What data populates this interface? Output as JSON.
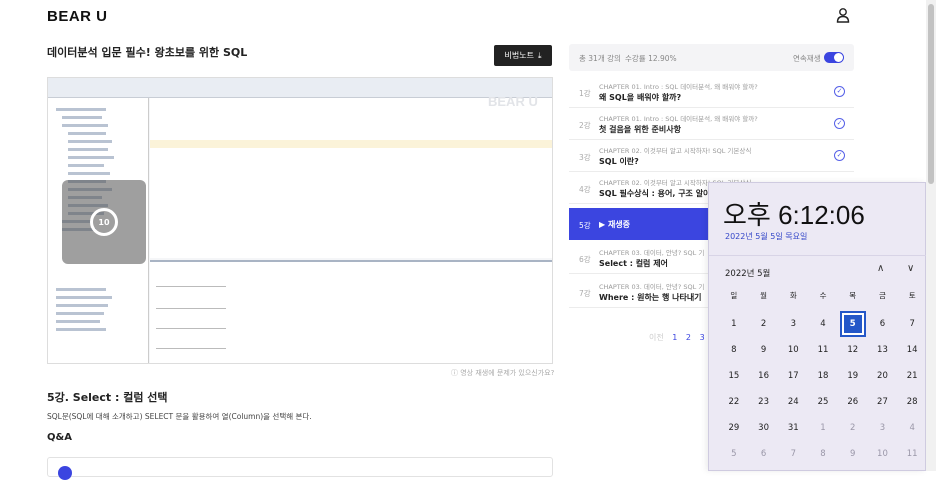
{
  "header": {
    "logo": "BEAR U",
    "user_icon": "user-icon"
  },
  "course": {
    "title": "데이터분석 입문 필수! 왕초보를 위한 SQL",
    "notes_button": "비법노트"
  },
  "video": {
    "watermark": "BEAR U",
    "replay_seconds": "10",
    "report_link": "ⓘ 영상 재생에 문제가 있으신가요?"
  },
  "lesson": {
    "title": "5강. Select : 컬럼 선택",
    "description": "SQL문(SQL에 대해 소개하고) SELECT 문을 활용하여 열(Column)을 선택해 본다.",
    "qa_title": "Q&A"
  },
  "sidebar": {
    "total": "총 31개 강의",
    "rate": "수강률 12.90%",
    "autoplay_label": "연속재생",
    "autoplay_on": true,
    "lectures": [
      {
        "num": "1강",
        "chapter": "CHAPTER 01. Intro : SQL 데이터분석, 왜 배워야 할까?",
        "name": "왜 SQL을 배워야 할까?",
        "done": true
      },
      {
        "num": "2강",
        "chapter": "CHAPTER 01. Intro : SQL 데이터분석, 왜 배워야 할까?",
        "name": "첫 걸음을 위한 준비사항",
        "done": true
      },
      {
        "num": "3강",
        "chapter": "CHAPTER 02. 이것부터 알고 시작하자! SQL 기본상식",
        "name": "SQL 이란?",
        "done": true
      },
      {
        "num": "4강",
        "chapter": "CHAPTER 02. 이것부터 알고 시작하자! SQL 기본상식",
        "name": "SQL 필수상식 : 용어, 구조 알아보",
        "done": false
      },
      {
        "num": "5강",
        "now_playing": "▶ 재생중",
        "active": true
      },
      {
        "num": "6강",
        "chapter": "CHAPTER 03. 데이터, 안녕? SQL 기",
        "name": "Select : 컬럼 제어",
        "done": false
      },
      {
        "num": "7강",
        "chapter": "CHAPTER 03. 데이터, 안녕? SQL 기",
        "name": "Where : 원하는 행 나타내기",
        "done": false
      }
    ],
    "pager": {
      "prev": "이전",
      "pages": [
        "1",
        "2",
        "3"
      ]
    }
  },
  "clock": {
    "time": "오후 6:12:06",
    "date": "2022년 5월 5일 목요일",
    "month": "2022년 5월",
    "weekdays": [
      "일",
      "월",
      "화",
      "수",
      "목",
      "금",
      "토"
    ],
    "weeks": [
      [
        {
          "d": "1"
        },
        {
          "d": "2"
        },
        {
          "d": "3"
        },
        {
          "d": "4"
        },
        {
          "d": "5",
          "today": true
        },
        {
          "d": "6"
        },
        {
          "d": "7"
        }
      ],
      [
        {
          "d": "8"
        },
        {
          "d": "9"
        },
        {
          "d": "10"
        },
        {
          "d": "11"
        },
        {
          "d": "12"
        },
        {
          "d": "13"
        },
        {
          "d": "14"
        }
      ],
      [
        {
          "d": "15"
        },
        {
          "d": "16"
        },
        {
          "d": "17"
        },
        {
          "d": "18"
        },
        {
          "d": "19"
        },
        {
          "d": "20"
        },
        {
          "d": "21"
        }
      ],
      [
        {
          "d": "22"
        },
        {
          "d": "23"
        },
        {
          "d": "24"
        },
        {
          "d": "25"
        },
        {
          "d": "26"
        },
        {
          "d": "27"
        },
        {
          "d": "28"
        }
      ],
      [
        {
          "d": "29"
        },
        {
          "d": "30"
        },
        {
          "d": "31"
        },
        {
          "d": "1",
          "other": true
        },
        {
          "d": "2",
          "other": true
        },
        {
          "d": "3",
          "other": true
        },
        {
          "d": "4",
          "other": true
        }
      ],
      [
        {
          "d": "5",
          "other": true
        },
        {
          "d": "6",
          "other": true
        },
        {
          "d": "7",
          "other": true
        },
        {
          "d": "8",
          "other": true
        },
        {
          "d": "9",
          "other": true
        },
        {
          "d": "10",
          "other": true
        },
        {
          "d": "11",
          "other": true
        }
      ]
    ]
  },
  "colors": {
    "accent": "#3b45e0",
    "today": "#2457c8"
  }
}
